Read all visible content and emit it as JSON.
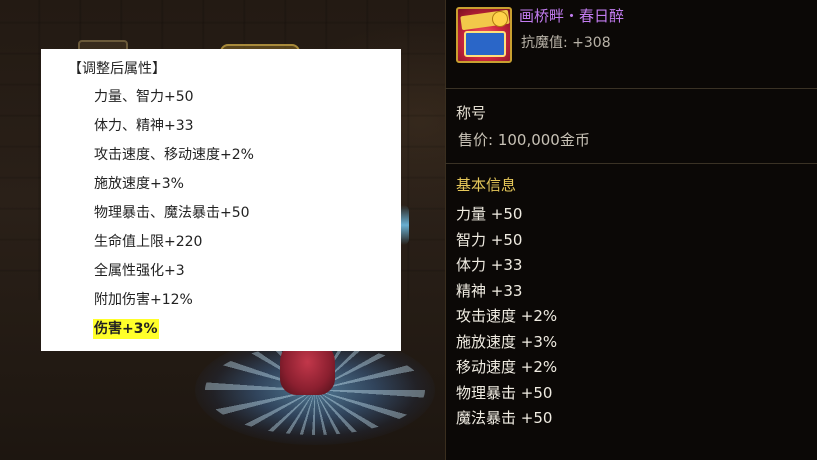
{
  "attributes_panel": {
    "header": "【调整后属性】",
    "rows": [
      "力量、智力+50",
      "体力、精神+33",
      "攻击速度、移动速度+2%",
      "施放速度+3%",
      "物理暴击、魔法暴击+50",
      "生命值上限+220",
      "全属性强化+3",
      "附加伤害+12%",
      "伤害+3%"
    ],
    "highlight_color": "#ffff2a"
  },
  "tooltip": {
    "item_name": "画桥畔・春日醉",
    "item_name_color": "#c27cf0",
    "resist": "抗魔值: +308",
    "type": "称号",
    "price": "售价: 100,000金币",
    "basic_info_title": "基本信息",
    "basic_info_title_color": "#e6c85a",
    "stats": [
      "力量 +50",
      "智力 +50",
      "体力 +33",
      "精神 +33",
      "攻击速度 +2%",
      "施放速度 +3%",
      "移动速度 +2%",
      "物理暴击 +50",
      "魔法暴击 +50"
    ],
    "icon": "title-emblem-icon"
  }
}
